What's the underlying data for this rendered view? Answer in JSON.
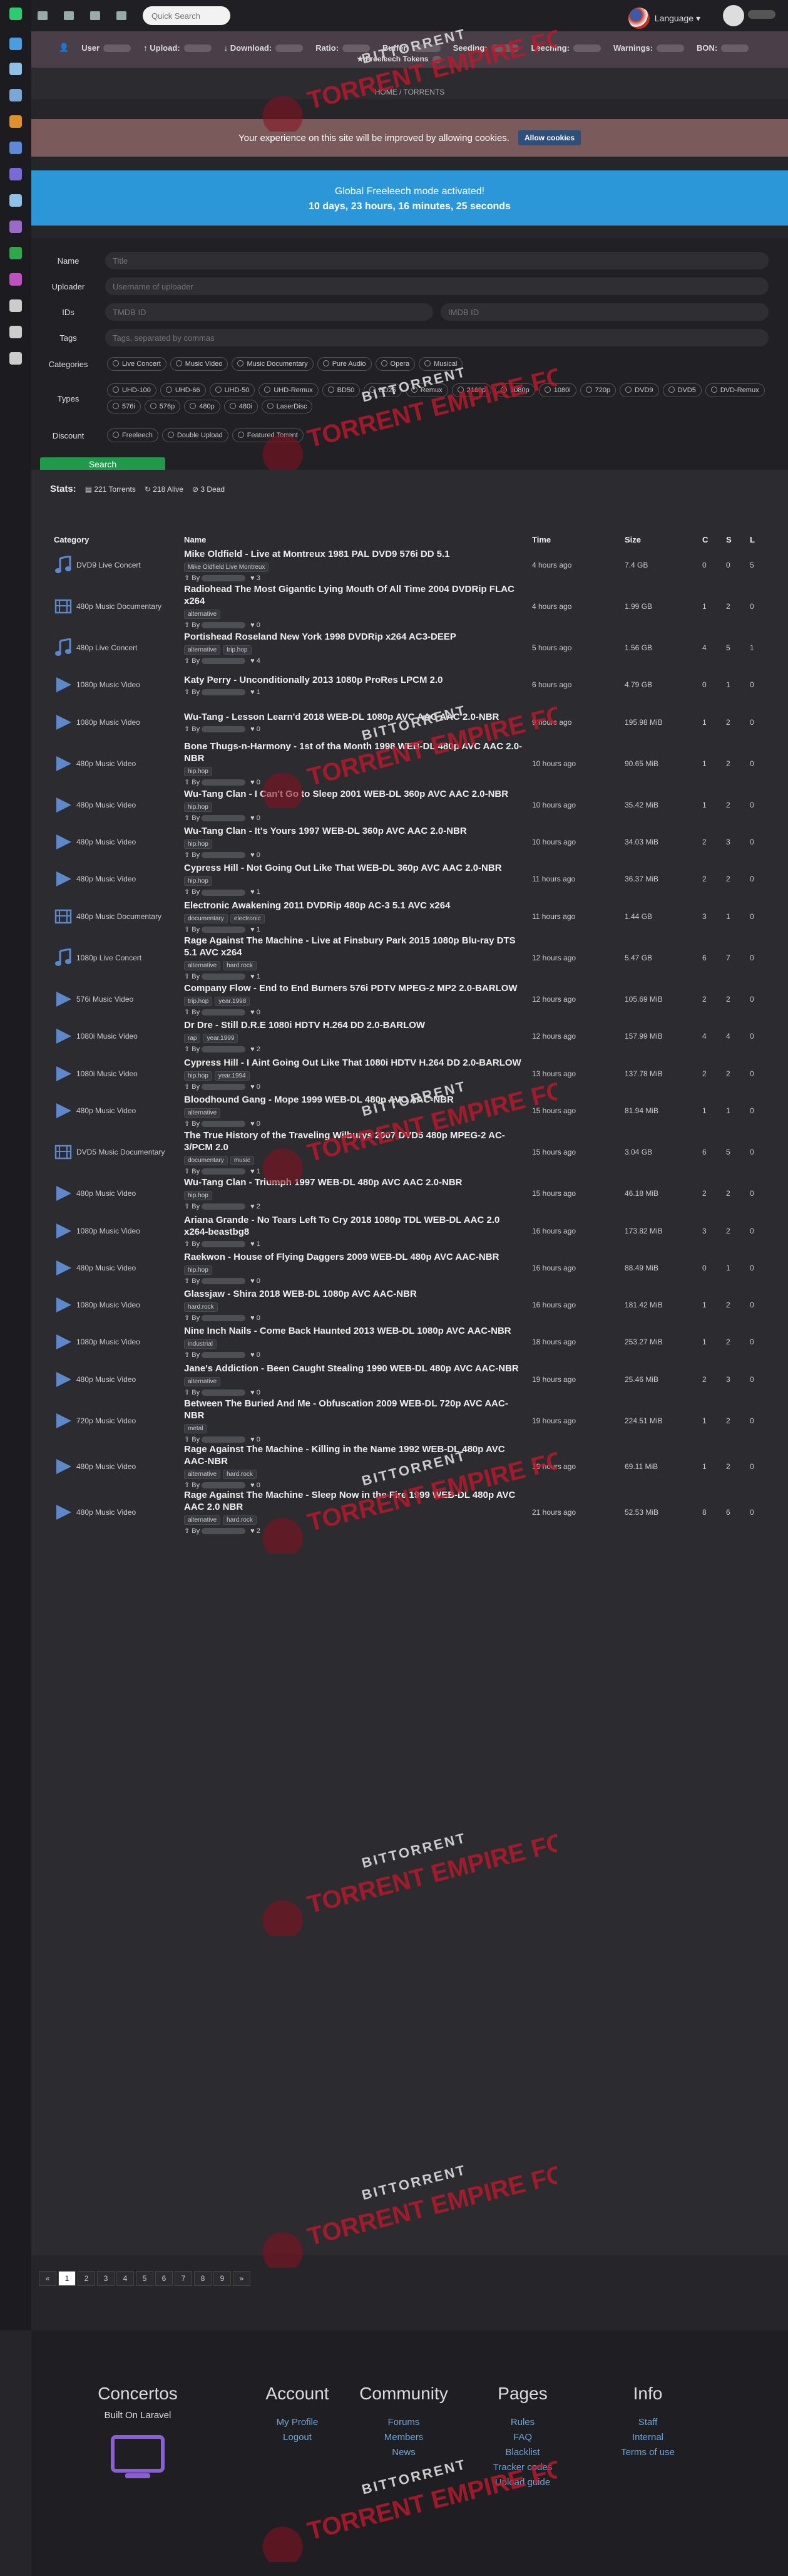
{
  "nav": {
    "search_placeholder": "Quick Search",
    "language": "Language"
  },
  "ratio": {
    "user": "User",
    "upload": "Upload:",
    "download": "Download:",
    "ratio": "Ratio:",
    "buffer": "Buffer:",
    "seeding": "Seeding:",
    "leeching": "Leeching:",
    "warnings": "Warnings:",
    "bon": "BON:",
    "freeleech": "Freeleech Tokens"
  },
  "breadcrumb": "HOME / TORRENTS",
  "cookie": {
    "text": "Your experience on this site will be improved by allowing cookies.",
    "button": "Allow cookies"
  },
  "freeleech": {
    "title": "Global Freeleech mode activated!",
    "countdown": "10 days, 23 hours, 16 minutes, 25 seconds"
  },
  "filters": {
    "name_label": "Name",
    "name_placeholder": "Title",
    "uploader_label": "Uploader",
    "uploader_placeholder": "Username of uploader",
    "ids_label": "IDs",
    "tmdb_placeholder": "TMDB ID",
    "imdb_placeholder": "IMDB ID",
    "tags_label": "Tags",
    "tags_placeholder": "Tags, separated by commas",
    "categories_label": "Categories",
    "categories": [
      "Live Concert",
      "Music Video",
      "Music Documentary",
      "Pure Audio",
      "Opera",
      "Musical"
    ],
    "types_label": "Types",
    "types": [
      "UHD-100",
      "UHD-66",
      "UHD-50",
      "UHD-Remux",
      "BD50",
      "BD25",
      "Remux",
      "2160p",
      "1080p",
      "1080i",
      "720p",
      "DVD9",
      "DVD5",
      "DVD-Remux",
      "576i",
      "576p",
      "480p",
      "480i",
      "LaserDisc"
    ],
    "discount_label": "Discount",
    "discounts": [
      "Freeleech",
      "Double Upload",
      "Featured Torrent"
    ],
    "search_button": "Search"
  },
  "stats": {
    "label": "Stats:",
    "torrents": "221 Torrents",
    "alive": "218 Alive",
    "dead": "3 Dead"
  },
  "table": {
    "headers": [
      "Category",
      "Name",
      "Time",
      "Size",
      "C",
      "S",
      "L"
    ],
    "by": "By"
  },
  "torrents": [
    {
      "cat": "DVD9 Live Concert",
      "icon": "music",
      "name": "Mike Oldfield - Live at Montreux 1981 PAL DVD9 576i DD 5.1",
      "tags": [
        "Mike Oldfield Live Montreux"
      ],
      "thanks": "3",
      "time": "4 hours ago",
      "size": "7.4 GB",
      "c": "0",
      "s": "0",
      "l": "5"
    },
    {
      "cat": "480p Music Documentary",
      "icon": "film",
      "name": "Radiohead The Most Gigantic Lying Mouth Of All Time 2004 DVDRip FLAC x264",
      "tags": [
        "alternative"
      ],
      "thanks": "0",
      "time": "4 hours ago",
      "size": "1.99 GB",
      "c": "1",
      "s": "2",
      "l": "0"
    },
    {
      "cat": "480p Live Concert",
      "icon": "music",
      "name": "Portishead Roseland New York 1998 DVDRip x264 AC3-DEEP",
      "tags": [
        "alternative",
        "trip.hop"
      ],
      "thanks": "4",
      "time": "5 hours ago",
      "size": "1.56 GB",
      "c": "4",
      "s": "5",
      "l": "1"
    },
    {
      "cat": "1080p Music Video",
      "icon": "play",
      "name": "Katy Perry - Unconditionally 2013 1080p ProRes LPCM 2.0",
      "tags": [],
      "thanks": "1",
      "time": "6 hours ago",
      "size": "4.79 GB",
      "c": "0",
      "s": "1",
      "l": "0"
    },
    {
      "cat": "1080p Music Video",
      "icon": "play",
      "name": "Wu-Tang - Lesson Learn'd 2018 WEB-DL 1080p AVC AAC AAC 2.0-NBR",
      "tags": [],
      "thanks": "0",
      "time": "9 hours ago",
      "size": "195.98 MiB",
      "c": "1",
      "s": "2",
      "l": "0"
    },
    {
      "cat": "480p Music Video",
      "icon": "play",
      "name": "Bone Thugs-n-Harmony - 1st of tha Month 1998 WEB-DL 480p AVC AAC 2.0-NBR",
      "tags": [
        "hip.hop"
      ],
      "thanks": "0",
      "time": "10 hours ago",
      "size": "90.65 MiB",
      "c": "1",
      "s": "2",
      "l": "0"
    },
    {
      "cat": "480p Music Video",
      "icon": "play",
      "name": "Wu-Tang Clan - I Can't Go to Sleep 2001 WEB-DL 360p AVC AAC 2.0-NBR",
      "tags": [
        "hip.hop"
      ],
      "thanks": "0",
      "time": "10 hours ago",
      "size": "35.42 MiB",
      "c": "1",
      "s": "2",
      "l": "0"
    },
    {
      "cat": "480p Music Video",
      "icon": "play",
      "name": "Wu-Tang Clan - It's Yours 1997 WEB-DL 360p AVC AAC 2.0-NBR",
      "tags": [
        "hip.hop"
      ],
      "thanks": "0",
      "time": "10 hours ago",
      "size": "34.03 MiB",
      "c": "2",
      "s": "3",
      "l": "0"
    },
    {
      "cat": "480p Music Video",
      "icon": "play",
      "name": "Cypress Hill - Not Going Out Like That WEB-DL 360p AVC AAC 2.0-NBR",
      "tags": [
        "hip.hop"
      ],
      "thanks": "1",
      "time": "11 hours ago",
      "size": "36.37 MiB",
      "c": "2",
      "s": "2",
      "l": "0"
    },
    {
      "cat": "480p Music Documentary",
      "icon": "film",
      "name": "Electronic Awakening 2011 DVDRip 480p AC-3 5.1 AVC x264",
      "tags": [
        "documentary",
        "electronic"
      ],
      "thanks": "1",
      "time": "11 hours ago",
      "size": "1.44 GB",
      "c": "3",
      "s": "1",
      "l": "0"
    },
    {
      "cat": "1080p Live Concert",
      "icon": "music",
      "name": "Rage Against The Machine - Live at Finsbury Park 2015 1080p Blu-ray DTS 5.1 AVC x264",
      "tags": [
        "alternative",
        "hard.rock"
      ],
      "thanks": "1",
      "time": "12 hours ago",
      "size": "5.47 GB",
      "c": "6",
      "s": "7",
      "l": "0"
    },
    {
      "cat": "576i Music Video",
      "icon": "play",
      "name": "Company Flow - End to End Burners 576i PDTV MPEG-2 MP2 2.0-BARLOW",
      "tags": [
        "trip.hop",
        "year.1998"
      ],
      "thanks": "0",
      "time": "12 hours ago",
      "size": "105.69 MiB",
      "c": "2",
      "s": "2",
      "l": "0"
    },
    {
      "cat": "1080i Music Video",
      "icon": "play",
      "name": "Dr Dre - Still D.R.E 1080i HDTV H.264 DD 2.0-BARLOW",
      "tags": [
        "rap",
        "year.1999"
      ],
      "thanks": "2",
      "time": "12 hours ago",
      "size": "157.99 MiB",
      "c": "4",
      "s": "4",
      "l": "0"
    },
    {
      "cat": "1080i Music Video",
      "icon": "play",
      "name": "Cypress Hill - I Aint Going Out Like That 1080i HDTV H.264 DD 2.0-BARLOW",
      "tags": [
        "hip.hop",
        "year.1994"
      ],
      "thanks": "0",
      "time": "13 hours ago",
      "size": "137.78 MiB",
      "c": "2",
      "s": "2",
      "l": "0"
    },
    {
      "cat": "480p Music Video",
      "icon": "play",
      "name": "Bloodhound Gang - Mope 1999 WEB-DL 480p AVC AAC-NBR",
      "tags": [
        "alternative"
      ],
      "thanks": "0",
      "time": "15 hours ago",
      "size": "81.94 MiB",
      "c": "1",
      "s": "1",
      "l": "0"
    },
    {
      "cat": "DVD5 Music Documentary",
      "icon": "film",
      "name": "The True History of the Traveling Wilburys 2007 DVD5 480p MPEG-2 AC-3/PCM 2.0",
      "tags": [
        "documentary",
        "music"
      ],
      "thanks": "1",
      "time": "15 hours ago",
      "size": "3.04 GB",
      "c": "6",
      "s": "5",
      "l": "0"
    },
    {
      "cat": "480p Music Video",
      "icon": "play",
      "name": "Wu-Tang Clan - Triumph 1997 WEB-DL 480p AVC AAC 2.0-NBR",
      "tags": [
        "hip.hop"
      ],
      "thanks": "2",
      "time": "15 hours ago",
      "size": "46.18 MiB",
      "c": "2",
      "s": "2",
      "l": "0"
    },
    {
      "cat": "1080p Music Video",
      "icon": "play",
      "name": "Ariana Grande - No Tears Left To Cry 2018 1080p TDL WEB-DL AAC 2.0 x264-beastbg8",
      "tags": [],
      "thanks": "1",
      "time": "16 hours ago",
      "size": "173.82 MiB",
      "c": "3",
      "s": "2",
      "l": "0"
    },
    {
      "cat": "480p Music Video",
      "icon": "play",
      "name": "Raekwon - House of Flying Daggers 2009 WEB-DL 480p AVC AAC-NBR",
      "tags": [
        "hip.hop"
      ],
      "thanks": "0",
      "time": "16 hours ago",
      "size": "88.49 MiB",
      "c": "0",
      "s": "1",
      "l": "0"
    },
    {
      "cat": "1080p Music Video",
      "icon": "play",
      "name": "Glassjaw - Shira 2018 WEB-DL 1080p AVC AAC-NBR",
      "tags": [
        "hard.rock"
      ],
      "thanks": "0",
      "time": "16 hours ago",
      "size": "181.42 MiB",
      "c": "1",
      "s": "2",
      "l": "0"
    },
    {
      "cat": "1080p Music Video",
      "icon": "play",
      "name": "Nine Inch Nails - Come Back Haunted 2013 WEB-DL 1080p AVC AAC-NBR",
      "tags": [
        "industrial"
      ],
      "thanks": "0",
      "time": "18 hours ago",
      "size": "253.27 MiB",
      "c": "1",
      "s": "2",
      "l": "0"
    },
    {
      "cat": "480p Music Video",
      "icon": "play",
      "name": "Jane's Addiction - Been Caught Stealing 1990 WEB-DL 480p AVC AAC-NBR",
      "tags": [
        "alternative"
      ],
      "thanks": "0",
      "time": "19 hours ago",
      "size": "25.46 MiB",
      "c": "2",
      "s": "3",
      "l": "0"
    },
    {
      "cat": "720p Music Video",
      "icon": "play",
      "name": "Between The Buried And Me - Obfuscation 2009 WEB-DL 720p AVC AAC-NBR",
      "tags": [
        "metal"
      ],
      "thanks": "0",
      "time": "19 hours ago",
      "size": "224.51 MiB",
      "c": "1",
      "s": "2",
      "l": "0"
    },
    {
      "cat": "480p Music Video",
      "icon": "play",
      "name": "Rage Against The Machine - Killing in the Name 1992 WEB-DL 480p AVC AAC-NBR",
      "tags": [
        "alternative",
        "hard.rock"
      ],
      "thanks": "0",
      "time": "19 hours ago",
      "size": "69.11 MiB",
      "c": "1",
      "s": "2",
      "l": "0"
    },
    {
      "cat": "480p Music Video",
      "icon": "play",
      "name": "Rage Against The Machine - Sleep Now in the Fire 1999 WEB-DL 480p AVC AAC 2.0 NBR",
      "tags": [
        "alternative",
        "hard.rock"
      ],
      "thanks": "2",
      "time": "21 hours ago",
      "size": "52.53 MiB",
      "c": "8",
      "s": "6",
      "l": "0"
    }
  ],
  "pagination": [
    "«",
    "1",
    "2",
    "3",
    "4",
    "5",
    "6",
    "7",
    "8",
    "9",
    "»"
  ],
  "footer": {
    "brand": "Concertos",
    "built": "Built On Laravel",
    "cols": [
      {
        "title": "Account",
        "links": [
          "My Profile",
          "Logout"
        ]
      },
      {
        "title": "Community",
        "links": [
          "Forums",
          "Members",
          "News"
        ]
      },
      {
        "title": "Pages",
        "links": [
          "Rules",
          "FAQ",
          "Blacklist",
          "Tracker codes",
          "Upload guide"
        ]
      },
      {
        "title": "Info",
        "links": [
          "Staff",
          "Internal",
          "Terms of use"
        ]
      }
    ]
  },
  "watermark": {
    "top": "BITTORRENT",
    "main": "TORRENT EMPIRE FORUM"
  },
  "colors": {
    "accent": "#2b96d8",
    "search": "#1e9a4a",
    "cookie": "#7a5a5a",
    "link": "#6fa3d8",
    "watermark": "#c0182a"
  }
}
